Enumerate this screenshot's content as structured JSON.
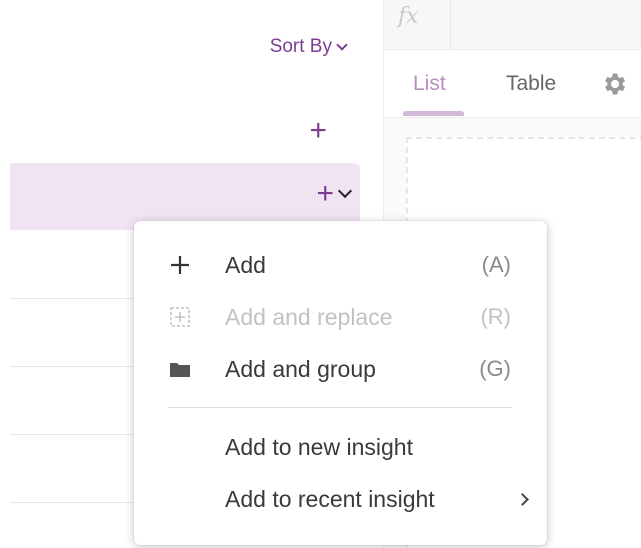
{
  "sort": {
    "label": "Sort By"
  },
  "formula_bar": {
    "symbol": "fx"
  },
  "tabs": [
    {
      "label": "List",
      "active": true
    },
    {
      "label": "Table",
      "active": false
    }
  ],
  "menu": {
    "items": [
      {
        "label": "Add",
        "shortcut": "(A)",
        "icon": "plus-icon",
        "disabled": false
      },
      {
        "label": "Add and replace",
        "shortcut": "(R)",
        "icon": "add-replace-icon",
        "disabled": true
      },
      {
        "label": "Add and group",
        "shortcut": "(G)",
        "icon": "folder-icon",
        "disabled": false
      },
      {
        "label": "Add to new insight",
        "shortcut": "",
        "icon": "",
        "disabled": false
      },
      {
        "label": "Add to recent insight",
        "shortcut": "",
        "icon": "chevron-right-icon",
        "disabled": false
      }
    ]
  },
  "colors": {
    "accent": "#7a3d92",
    "highlight_row": "#f1e4f2",
    "tab_active": "#b98cc0"
  }
}
